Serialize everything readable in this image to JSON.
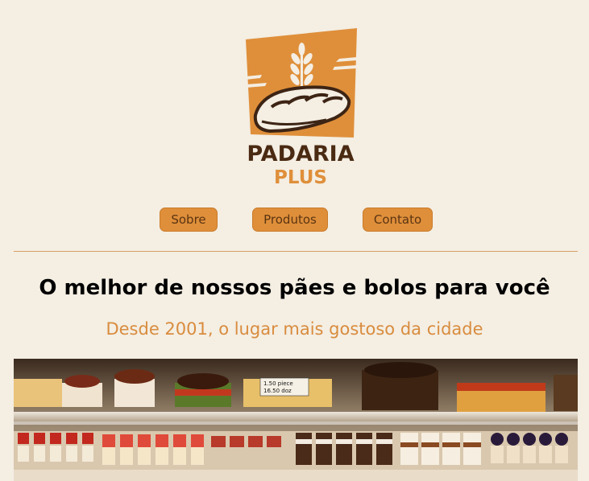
{
  "logo": {
    "line1": "PADARIA",
    "line2": "PLUS",
    "icon": "bread-wheat-logo",
    "colors": {
      "badge": "#df8f3a",
      "dark": "#4a2a12",
      "accent": "#df8f3a"
    }
  },
  "nav": {
    "items": [
      {
        "label": "Sobre"
      },
      {
        "label": "Produtos"
      },
      {
        "label": "Contato"
      }
    ],
    "colors": {
      "button": "#df8f3a",
      "text": "#5b3412"
    }
  },
  "main": {
    "headline": "O melhor de nossos pães e bolos para você",
    "tagline": "Desde 2001, o lugar mais gostoso da cidade"
  },
  "hero": {
    "image": "bakery-display-case-photo",
    "price_tag": {
      "line1": "1.50 piece",
      "line2": "16.50 doz"
    }
  }
}
